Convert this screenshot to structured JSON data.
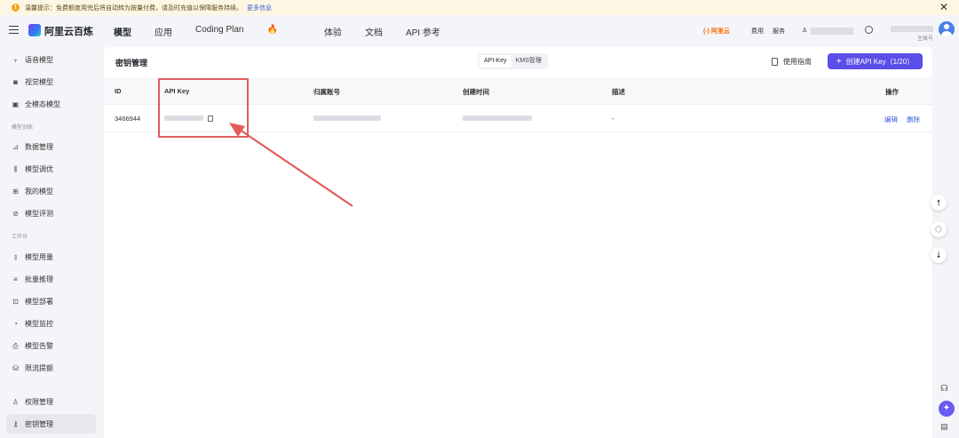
{
  "notice": {
    "text": "温馨提示：免费额度用完后将自动转为按量付费，请及时充值以保障服务持续。",
    "more_link": "更多信息",
    "close": "✕"
  },
  "header": {
    "brand": "阿里云百炼",
    "nav": [
      "模型",
      "应用",
      "Coding Plan",
      "体验",
      "文档",
      "API 参考"
    ],
    "coding_plan_emoji": "🔥",
    "aliyun_logo": "(-) 阿里云",
    "links": [
      "费用",
      "服务"
    ],
    "account_subtitle": "主账号"
  },
  "sidebar": {
    "items_top": [
      {
        "label": "语音模型",
        "icon": "waveform-icon"
      },
      {
        "label": "视觉模型",
        "icon": "camera-icon"
      },
      {
        "label": "全模态模型",
        "icon": "multimodal-icon"
      }
    ],
    "group_train": "模型训练",
    "items_train": [
      {
        "label": "数据管理",
        "icon": "chart-icon"
      },
      {
        "label": "模型调优",
        "icon": "sliders-icon"
      },
      {
        "label": "我的模型",
        "icon": "grid-icon"
      },
      {
        "label": "模型评测",
        "icon": "compass-icon"
      }
    ],
    "group_workbench": "工作台",
    "items_workbench": [
      {
        "label": "模型用量",
        "icon": "bar-chart-icon"
      },
      {
        "label": "批量推理",
        "icon": "list-icon"
      },
      {
        "label": "模型部署",
        "icon": "deploy-icon"
      },
      {
        "label": "模型监控",
        "icon": "pie-icon"
      },
      {
        "label": "模型告警",
        "icon": "bell-doc-icon"
      },
      {
        "label": "限流提额",
        "icon": "database-icon"
      }
    ],
    "items_bottom": [
      {
        "label": "权限管理",
        "icon": "user-icon"
      },
      {
        "label": "密钥管理",
        "icon": "key-icon",
        "active": true
      }
    ]
  },
  "main": {
    "title": "密钥管理",
    "tabs": [
      {
        "label": "API-Key",
        "selected": true
      },
      {
        "label": "KMS管理",
        "selected": false
      }
    ],
    "guide": "使用指南",
    "create_button": "创建API Key（1/20）",
    "table": {
      "headers": [
        "ID",
        "API Key",
        "归属账号",
        "创建时间",
        "描述",
        "操作"
      ],
      "rows": [
        {
          "id": "3466944",
          "description": "-",
          "edit": "编辑",
          "delete": "删除"
        }
      ]
    }
  },
  "colors": {
    "primary": "#5b4ee8",
    "link": "#3b5bdb",
    "annotation": "#e25c5c",
    "notice_bg": "#fdf6e3"
  }
}
